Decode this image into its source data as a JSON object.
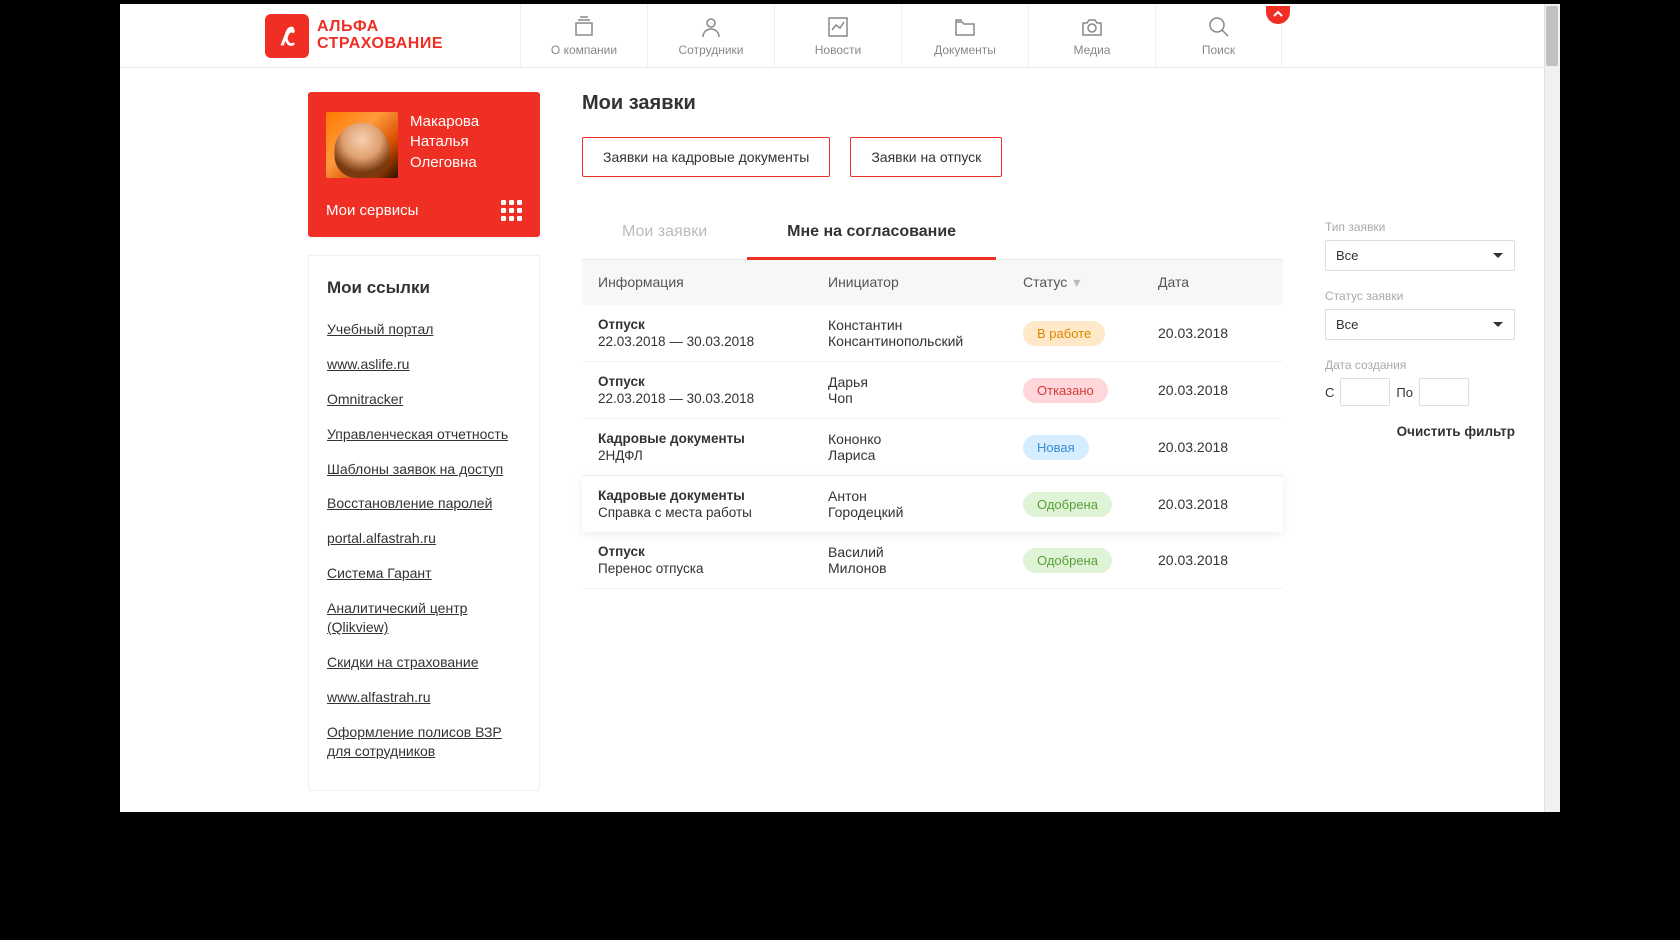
{
  "brand": {
    "line1": "АЛЬФА",
    "line2": "СТРАХОВАНИЕ"
  },
  "nav": {
    "about": {
      "label": "О компании"
    },
    "staff": {
      "label": "Сотрудники"
    },
    "news": {
      "label": "Новости"
    },
    "docs": {
      "label": "Документы"
    },
    "media": {
      "label": "Медиа"
    },
    "search": {
      "label": "Поиск"
    }
  },
  "profile": {
    "name_l1": "Макарова",
    "name_l2": "Наталья",
    "name_l3": "Олеговна",
    "services": "Мои сервисы"
  },
  "links": {
    "title": "Мои ссылки",
    "items": [
      "Учебный портал",
      "www.aslife.ru",
      "Omnitracker",
      "Управленческая отчетность",
      "Шаблоны заявок на доступ",
      "Восстановление паролей",
      "portal.alfastrah.ru",
      "Система Гарант",
      "Аналитический центр (Qlikview)",
      "Скидки на страхование",
      "www.alfastrah.ru",
      "Оформление полисов ВЗР для сотрудников"
    ]
  },
  "page": {
    "title": "Мои заявки",
    "btn_hr": "Заявки на кадровые документы",
    "btn_vac": "Заявки на отпуск"
  },
  "tabs": {
    "mine": "Мои заявки",
    "approve": "Мне на согласование"
  },
  "columns": {
    "info": "Информация",
    "initiator": "Инициатор",
    "status": "Статус",
    "date": "Дата"
  },
  "rows": [
    {
      "title": "Отпуск",
      "sub": "22.03.2018 — 30.03.2018",
      "init_l1": "Константин",
      "init_l2": "Консантинопольский",
      "status": "В работе",
      "status_cls": "pill-orange",
      "date": "20.03.2018",
      "hl": false
    },
    {
      "title": "Отпуск",
      "sub": "22.03.2018 — 30.03.2018",
      "init_l1": "Дарья",
      "init_l2": "Чоп",
      "status": "Отказано",
      "status_cls": "pill-red",
      "date": "20.03.2018",
      "hl": false
    },
    {
      "title": "Кадровые документы",
      "sub": "2НДФЛ",
      "init_l1": "Кононко",
      "init_l2": "Лариса",
      "status": "Новая",
      "status_cls": "pill-blue",
      "date": "20.03.2018",
      "hl": false
    },
    {
      "title": "Кадровые документы",
      "sub": "Справка с места работы",
      "init_l1": "Антон",
      "init_l2": "Городецкий",
      "status": "Одобрена",
      "status_cls": "pill-green",
      "date": "20.03.2018",
      "hl": true
    },
    {
      "title": "Отпуск",
      "sub": "Перенос отпуска",
      "init_l1": "Василий",
      "init_l2": "Милонов",
      "status": "Одобрена",
      "status_cls": "pill-green",
      "date": "20.03.2018",
      "hl": false
    }
  ],
  "filters": {
    "type_label": "Тип заявки",
    "type_value": "Все",
    "status_label": "Статус заявки",
    "status_value": "Все",
    "date_label": "Дата создания",
    "from": "С",
    "to": "По",
    "clear": "Очистить фильтр"
  }
}
